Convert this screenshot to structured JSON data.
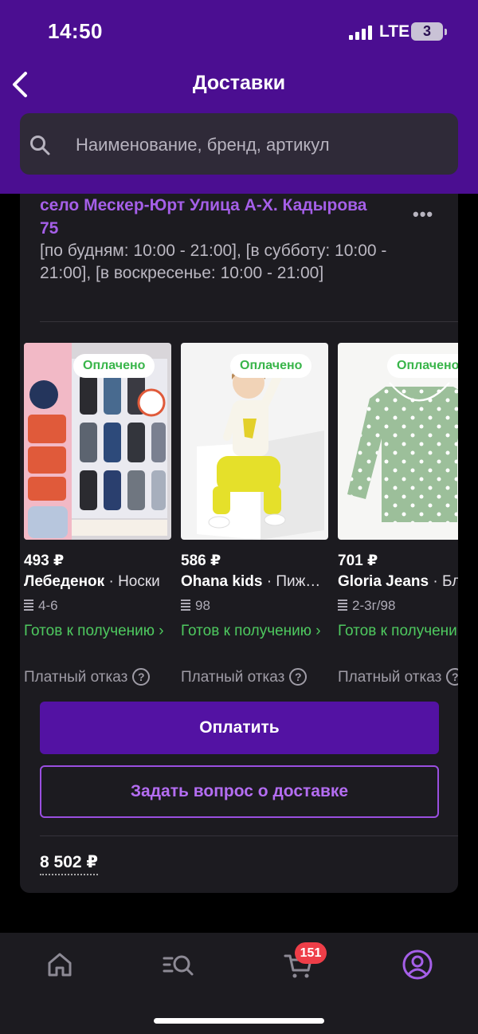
{
  "status_bar": {
    "time": "14:50",
    "network": "LTE",
    "battery": "3"
  },
  "header": {
    "title": "Доставки",
    "search_placeholder": "Наименование, бренд, артикул"
  },
  "delivery": {
    "address": "село Мескер-Юрт Улица А-Х. Кадырова 75",
    "hours": "[по будням: 10:00 - 21:00], [в субботу: 10:00 - 21:00], [в воскресенье: 10:00 - 21:00]",
    "more_label": "•••"
  },
  "products": [
    {
      "status": "Оплачено",
      "price": "493 ₽",
      "brand": "Лебеденок",
      "name": "Носки",
      "size": "4-6",
      "ready": "Готов к получению ›",
      "refusal": "Платный отказ",
      "image": "socks"
    },
    {
      "status": "Оплачено",
      "price": "586 ₽",
      "brand": "Ohana kids",
      "name": "Пижама",
      "size": "98",
      "ready": "Готов к получению ›",
      "refusal": "Платный отказ",
      "image": "kid-pajamas"
    },
    {
      "status": "Оплачено",
      "price": "701 ₽",
      "brand": "Gloria Jeans",
      "name": "Блузка",
      "size": "2-3г/98",
      "ready": "Готов к получению ›",
      "refusal": "Платный отказ",
      "image": "green-blouse"
    }
  ],
  "actions": {
    "pay": "Оплатить",
    "ask": "Задать вопрос о доставке"
  },
  "total": "8 502 ₽",
  "bottom_nav": {
    "items": [
      "home-icon",
      "catalog-search-icon",
      "cart-icon",
      "profile-icon"
    ],
    "cart_badge": "151"
  },
  "colors": {
    "header": "#4b0e91",
    "accent": "#a55fe8",
    "pay_button": "#5312a3",
    "ready": "#4ec95f",
    "badge": "#ee3e48"
  }
}
